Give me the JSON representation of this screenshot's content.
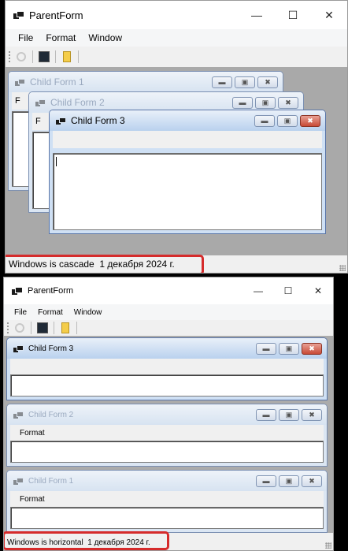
{
  "screens": [
    {
      "window_title": "ParentForm",
      "controls": {
        "minimize": "—",
        "maximize": "☐",
        "close": "✕"
      },
      "menu": [
        "File",
        "Format",
        "Window"
      ],
      "status": "Windows is cascade  1 декабря 2024 г.",
      "children": [
        {
          "title": "Child Form 1",
          "menu_label": "F",
          "active": false
        },
        {
          "title": "Child Form 2",
          "menu_label": "F",
          "active": false
        },
        {
          "title": "Child Form 3",
          "menu_label": "",
          "active": true
        }
      ]
    },
    {
      "window_title": "ParentForm",
      "controls": {
        "minimize": "—",
        "maximize": "☐",
        "close": "✕"
      },
      "menu": [
        "File",
        "Format",
        "Window"
      ],
      "status": "Windows is horizontal  1 декабря 2024 г.",
      "children": [
        {
          "title": "Child Form 3",
          "menu_label": "",
          "active": true
        },
        {
          "title": "Child Form 2",
          "menu_label": "Format",
          "active": false
        },
        {
          "title": "Child Form 1",
          "menu_label": "Format",
          "active": false
        }
      ]
    }
  ],
  "child_controls": {
    "minimize": "▬",
    "maximize": "▣",
    "close": "✖"
  },
  "toolbar_icons": [
    "clock-icon",
    "dark-square-icon",
    "yellow-document-icon"
  ],
  "colors": {
    "highlight": "#d52b2b",
    "mdi_background": "#a9a9a9",
    "active_close": "#c84a36"
  }
}
